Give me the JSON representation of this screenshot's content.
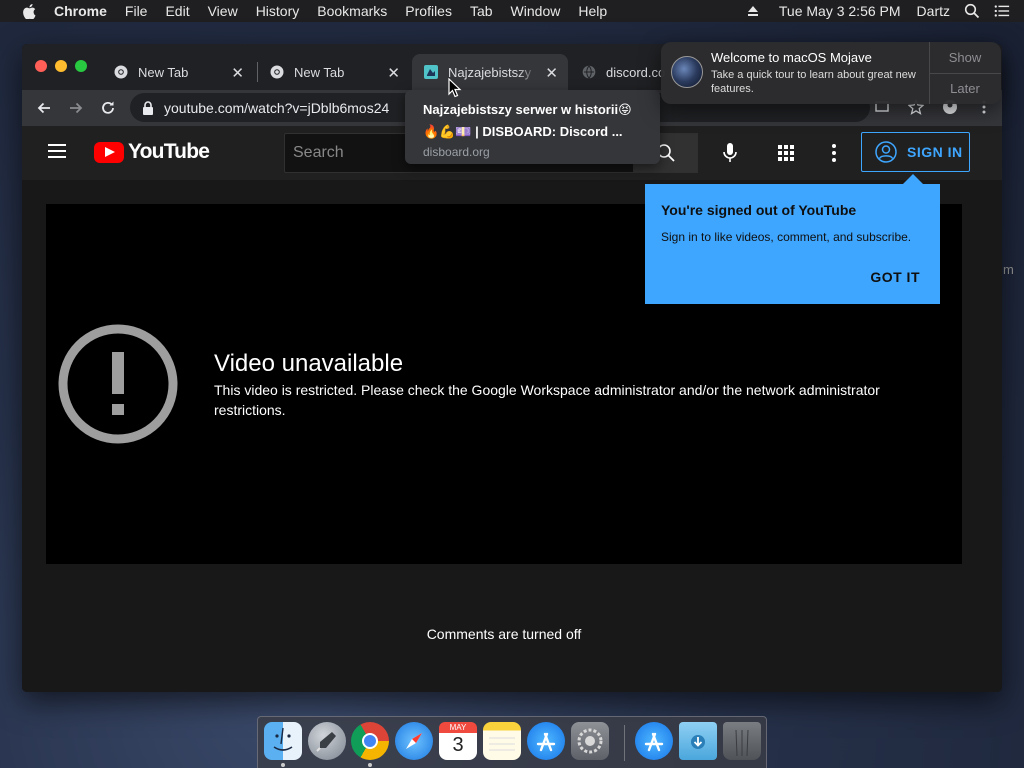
{
  "menubar": {
    "app": "Chrome",
    "items": [
      "File",
      "Edit",
      "View",
      "History",
      "Bookmarks",
      "Profiles",
      "Tab",
      "Window",
      "Help"
    ],
    "datetime": "Tue May 3  2:56 PM",
    "user": "Dartz"
  },
  "browser": {
    "tabs": [
      {
        "title": "New Tab"
      },
      {
        "title": "New Tab"
      },
      {
        "title": "Najzajebistszy s"
      },
      {
        "title": "discord.co"
      }
    ],
    "url": "youtube.com/watch?v=jDblb6mos24"
  },
  "hovercard": {
    "title_line1": "Najzajebistszy serwer w historii😝",
    "title_line2": "🔥💪💷 | DISBOARD: Discord ...",
    "domain": "disboard.org"
  },
  "youtube": {
    "logo_text": "YouTube",
    "search_placeholder": "Search",
    "signin_label": "SIGN IN",
    "error_title": "Video unavailable",
    "error_text": "This video is restricted. Please check the Google Workspace administrator and/or the network administrator restrictions.",
    "comments_off": "Comments are turned off"
  },
  "callout": {
    "title": "You're signed out of YouTube",
    "text": "Sign in to like videos, comment, and subscribe.",
    "button": "GOT IT"
  },
  "notification": {
    "title": "Welcome to macOS Mojave",
    "body": "Take a quick tour to learn about great new features.",
    "show": "Show",
    "later": "Later"
  },
  "dock": {
    "apps": [
      "finder-icon",
      "launchpad-icon",
      "chrome-icon",
      "safari-icon",
      "calendar-icon",
      "notes-icon",
      "app-store-icon",
      "system-preferences-icon",
      "app-store-downloads-icon",
      "downloads-folder-icon",
      "trash-icon"
    ],
    "calendar_month": "MAY",
    "calendar_day": "3"
  },
  "side_text": "m",
  "colors": {
    "yt_accent": "#3ea6ff",
    "yt_red": "#ff0000",
    "close": "#ff5f57",
    "minimize": "#febc2e",
    "zoom": "#28c840"
  }
}
